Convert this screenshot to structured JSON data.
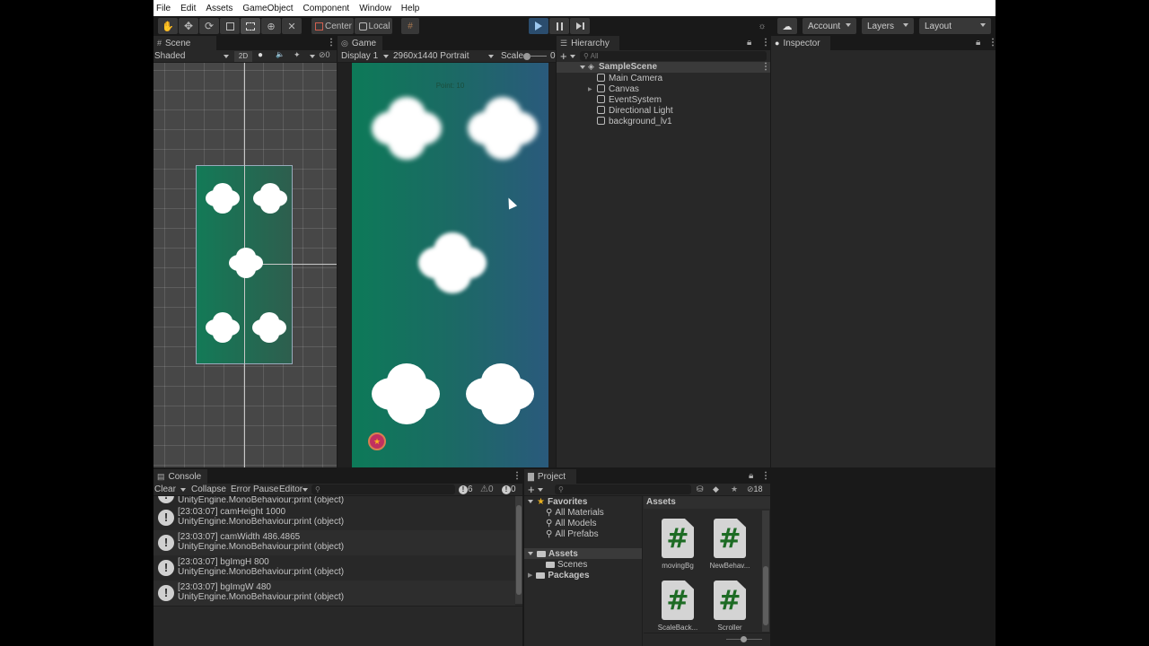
{
  "menu": [
    "File",
    "Edit",
    "Assets",
    "GameObject",
    "Component",
    "Window",
    "Help"
  ],
  "toolbar": {
    "tools": [
      "hand-tool",
      "move-tool",
      "rotate-tool",
      "scale-tool",
      "rect-tool",
      "transform-tool",
      "custom-tool"
    ],
    "active_tool": "rect-tool",
    "pivot_label": "Center",
    "space_label": "Local",
    "account_label": "Account",
    "layers_label": "Layers",
    "layout_label": "Layout"
  },
  "scene": {
    "tab_label": "Scene",
    "shading_mode": "Shaded",
    "mode_2d_label": "2D",
    "hidden_count": "0"
  },
  "game": {
    "tab_label": "Game",
    "display": "Display 1",
    "resolution": "2960x1440 Portrait",
    "scale_label": "Scale",
    "scale_value": "0",
    "score_text": "Point: 10"
  },
  "hierarchy": {
    "tab_label": "Hierarchy",
    "search_placeholder": "All",
    "scene_name": "SampleScene",
    "items": [
      {
        "label": "Main Camera",
        "expandable": false
      },
      {
        "label": "Canvas",
        "expandable": true
      },
      {
        "label": "EventSystem",
        "expandable": false
      },
      {
        "label": "Directional Light",
        "expandable": false
      },
      {
        "label": "background_lv1",
        "expandable": false
      }
    ]
  },
  "inspector": {
    "tab_label": "Inspector"
  },
  "console": {
    "tab_label": "Console",
    "clear_label": "Clear",
    "collapse_label": "Collapse",
    "error_pause_label": "Error Pause",
    "editor_label": "Editor",
    "search_placeholder": "",
    "log_count": "6",
    "warning_count": "0",
    "error_count": "0",
    "partial_entry": "UnityEngine.MonoBehaviour:print (object)",
    "entries": [
      {
        "message": "[23:03:07] camHeight 1000",
        "source": "UnityEngine.MonoBehaviour:print (object)"
      },
      {
        "message": "[23:03:07] camWidth 486.4865",
        "source": "UnityEngine.MonoBehaviour:print (object)"
      },
      {
        "message": "[23:03:07] bgImgH 800",
        "source": "UnityEngine.MonoBehaviour:print (object)"
      },
      {
        "message": "[23:03:07] bgImgW 480",
        "source": "UnityEngine.MonoBehaviour:print (object)"
      }
    ]
  },
  "project": {
    "tab_label": "Project",
    "hidden_packages_count": "18",
    "favorites_label": "Favorites",
    "favorites": [
      "All Materials",
      "All Models",
      "All Prefabs"
    ],
    "assets_label": "Assets",
    "assets_children": [
      "Scenes"
    ],
    "packages_label": "Packages",
    "breadcrumb": "Assets",
    "files": [
      "movingBg",
      "NewBehav...",
      "ScaleBack...",
      "Scroller"
    ]
  }
}
